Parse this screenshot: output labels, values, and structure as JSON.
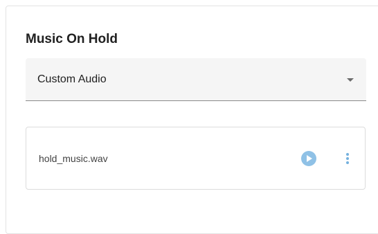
{
  "section": {
    "title": "Music On Hold"
  },
  "select": {
    "value": "Custom Audio",
    "icon": "dropdown-arrow-icon"
  },
  "file": {
    "name": "hold_music.wav",
    "play_icon": "play-circle-icon",
    "more_icon": "more-vertical-icon"
  },
  "colors": {
    "accent": "#8fc1e6",
    "more_dots": "#74b1de",
    "field_bg": "#f5f5f5"
  }
}
